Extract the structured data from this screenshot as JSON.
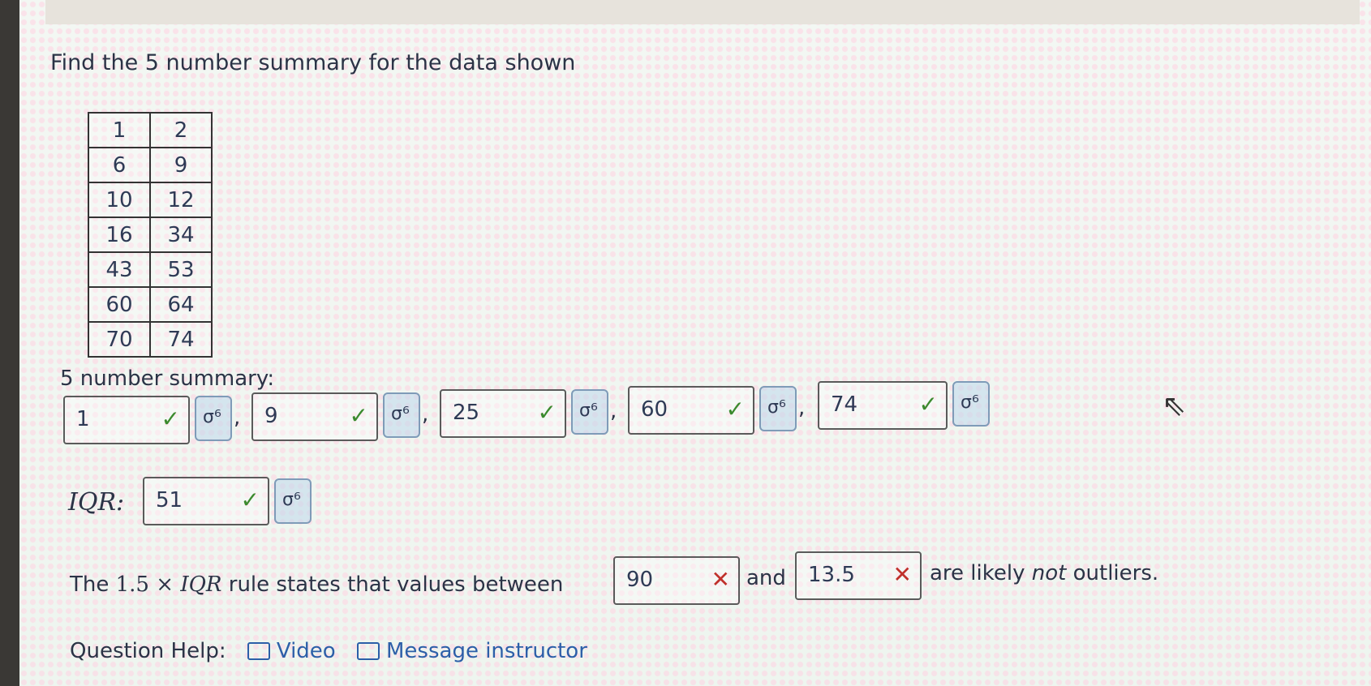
{
  "question": {
    "prompt": "Find the 5 number summary for the data shown"
  },
  "table": {
    "rows": [
      [
        "1",
        "2"
      ],
      [
        "6",
        "9"
      ],
      [
        "10",
        "12"
      ],
      [
        "16",
        "34"
      ],
      [
        "43",
        "53"
      ],
      [
        "60",
        "64"
      ],
      [
        "70",
        "74"
      ]
    ]
  },
  "summary": {
    "label": "5 number summary:",
    "answers": [
      {
        "value": "1",
        "status": "correct"
      },
      {
        "value": "9",
        "status": "correct"
      },
      {
        "value": "25",
        "status": "correct"
      },
      {
        "value": "60",
        "status": "correct"
      },
      {
        "value": "74",
        "status": "correct"
      }
    ],
    "separator": ","
  },
  "iqr": {
    "label": "IQR:",
    "value": "51",
    "status": "correct"
  },
  "outlier_rule": {
    "pre_text": "The",
    "factor": "1.5",
    "times": "×",
    "iqr_symbol": "IQR",
    "mid_text": "rule states that values between",
    "value1": "90",
    "status1": "incorrect",
    "and_text": "and",
    "value2": "13.5",
    "status2": "incorrect",
    "post_text": "are likely",
    "not_text": "not",
    "end_text": "outliers."
  },
  "help": {
    "label": "Question Help:",
    "video": "Video",
    "message": "Message instructor"
  },
  "icons": {
    "correct": "check-icon",
    "incorrect": "x-icon",
    "key": "key-icon",
    "video": "video-icon",
    "mail": "mail-icon",
    "cursor": "cursor-icon"
  },
  "colors": {
    "correct": "#3b8a2e",
    "incorrect": "#c0302b",
    "link": "#2c5fa8"
  }
}
